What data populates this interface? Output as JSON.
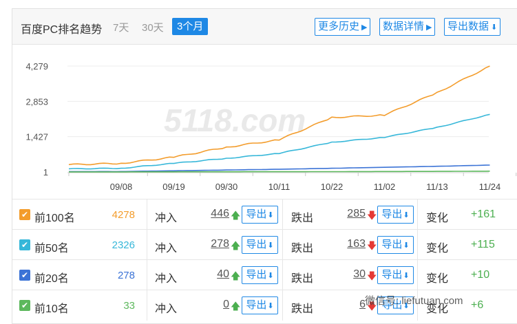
{
  "header": {
    "title": "百度PC排名趋势",
    "tabs": [
      "7天",
      "30天",
      "3个月"
    ],
    "active_tab": "3个月",
    "buttons": [
      {
        "label": "更多历史",
        "icon": "caret-right-icon"
      },
      {
        "label": "数据详情",
        "icon": "caret-right-icon"
      },
      {
        "label": "导出数据",
        "icon": "download-icon"
      }
    ]
  },
  "watermark_chart": "5118.com",
  "chart_data": {
    "type": "line",
    "x": [
      "09/08",
      "09/19",
      "09/30",
      "10/11",
      "10/22",
      "11/02",
      "11/13",
      "11/24"
    ],
    "yticks": [
      "4,279",
      "2,853",
      "1,427",
      "1"
    ],
    "ylim": [
      1,
      4279
    ],
    "series": [
      {
        "name": "前100名",
        "color": "#f39c2b",
        "values": [
          350,
          600,
          1000,
          1300,
          2200,
          2300,
          3200,
          4278
        ]
      },
      {
        "name": "前50名",
        "color": "#36b7d9",
        "values": [
          150,
          350,
          550,
          750,
          1200,
          1400,
          1800,
          2326
        ]
      },
      {
        "name": "前20名",
        "color": "#3b73d6",
        "values": [
          20,
          50,
          80,
          110,
          150,
          190,
          230,
          278
        ]
      },
      {
        "name": "前10名",
        "color": "#5cb85c",
        "values": [
          5,
          8,
          10,
          12,
          15,
          20,
          25,
          33
        ]
      }
    ]
  },
  "rows": [
    {
      "name": "前100名",
      "count": "4278",
      "count_color": "#f39c2b",
      "check_color": "#f39c2b",
      "in_label": "冲入",
      "in_num": "446",
      "out_label": "跌出",
      "out_num": "285",
      "export": "导出",
      "change_label": "变化",
      "change": "+161"
    },
    {
      "name": "前50名",
      "count": "2326",
      "count_color": "#36b7d9",
      "check_color": "#36b7d9",
      "in_label": "冲入",
      "in_num": "278",
      "out_label": "跌出",
      "out_num": "163",
      "export": "导出",
      "change_label": "变化",
      "change": "+115"
    },
    {
      "name": "前20名",
      "count": "278",
      "count_color": "#3b73d6",
      "check_color": "#3b73d6",
      "in_label": "冲入",
      "in_num": "40",
      "out_label": "跌出",
      "out_num": "30",
      "export": "导出",
      "change_label": "变化",
      "change": "+10"
    },
    {
      "name": "前10名",
      "count": "33",
      "count_color": "#5cb85c",
      "check_color": "#5cb85c",
      "in_label": "冲入",
      "in_num": "0",
      "out_label": "跌出",
      "out_num": "6",
      "export": "导出",
      "change_label": "变化",
      "change": "+6"
    }
  ],
  "watermark_overlay": "微信号: liefutuan.com",
  "colors": {
    "accent": "#1e88e5",
    "up": "#4caf50",
    "down": "#e53935"
  }
}
